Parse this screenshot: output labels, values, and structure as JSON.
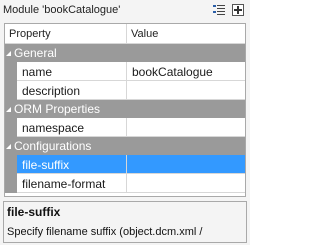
{
  "panel": {
    "title": "Module 'bookCatalogue'",
    "toolbar": {
      "categorized_icon": "categorized-view-icon",
      "alphabetical_icon": "alphabetical-view-icon"
    }
  },
  "grid": {
    "columns": [
      "Property",
      "Value"
    ],
    "categories": [
      {
        "label": "General",
        "rows": [
          {
            "name": "name",
            "value": "bookCatalogue"
          },
          {
            "name": "description",
            "value": ""
          }
        ]
      },
      {
        "label": "ORM Properties",
        "rows": [
          {
            "name": "namespace",
            "value": ""
          }
        ]
      },
      {
        "label": "Configurations",
        "rows": [
          {
            "name": "file-suffix",
            "value": "",
            "selected": true
          },
          {
            "name": "filename-format",
            "value": ""
          }
        ]
      }
    ]
  },
  "description": {
    "title": "file-suffix",
    "text": "Specify filename suffix (object.dcm.xml /"
  },
  "colors": {
    "category_bg": "#9a9a9a",
    "selection": "#3399ff",
    "border": "#a9a9a9"
  }
}
